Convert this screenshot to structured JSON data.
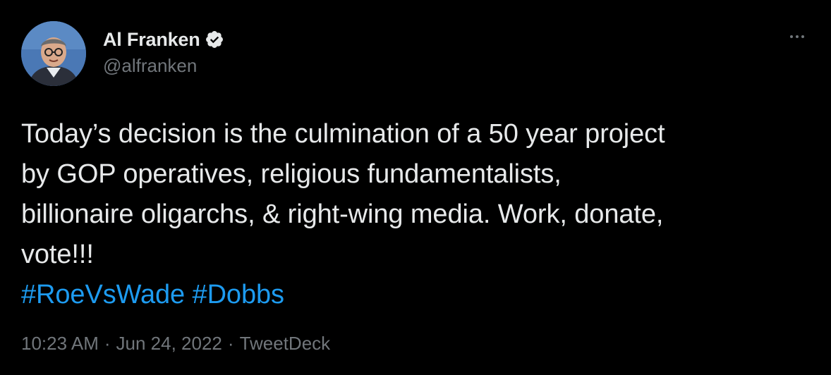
{
  "author": {
    "display_name": "Al Franken",
    "handle": "@alfranken",
    "verified": true,
    "avatar_icon": "avatar-photo"
  },
  "more_icon": "more-options-icon",
  "tweet": {
    "lines": [
      "Today’s decision is the culmination of a 50 year project",
      "by GOP operatives, religious fundamentalists,",
      "billionaire oligarchs, & right-wing media. Work, donate,",
      "vote!!!"
    ],
    "hashtags": [
      "#RoeVsWade",
      "#Dobbs"
    ]
  },
  "meta": {
    "time": "10:23 AM",
    "separator": "·",
    "date": "Jun 24, 2022",
    "source": "TweetDeck"
  },
  "colors": {
    "background": "#000000",
    "text": "#e7e9ea",
    "muted": "#71767b",
    "link": "#1d9bf0"
  }
}
